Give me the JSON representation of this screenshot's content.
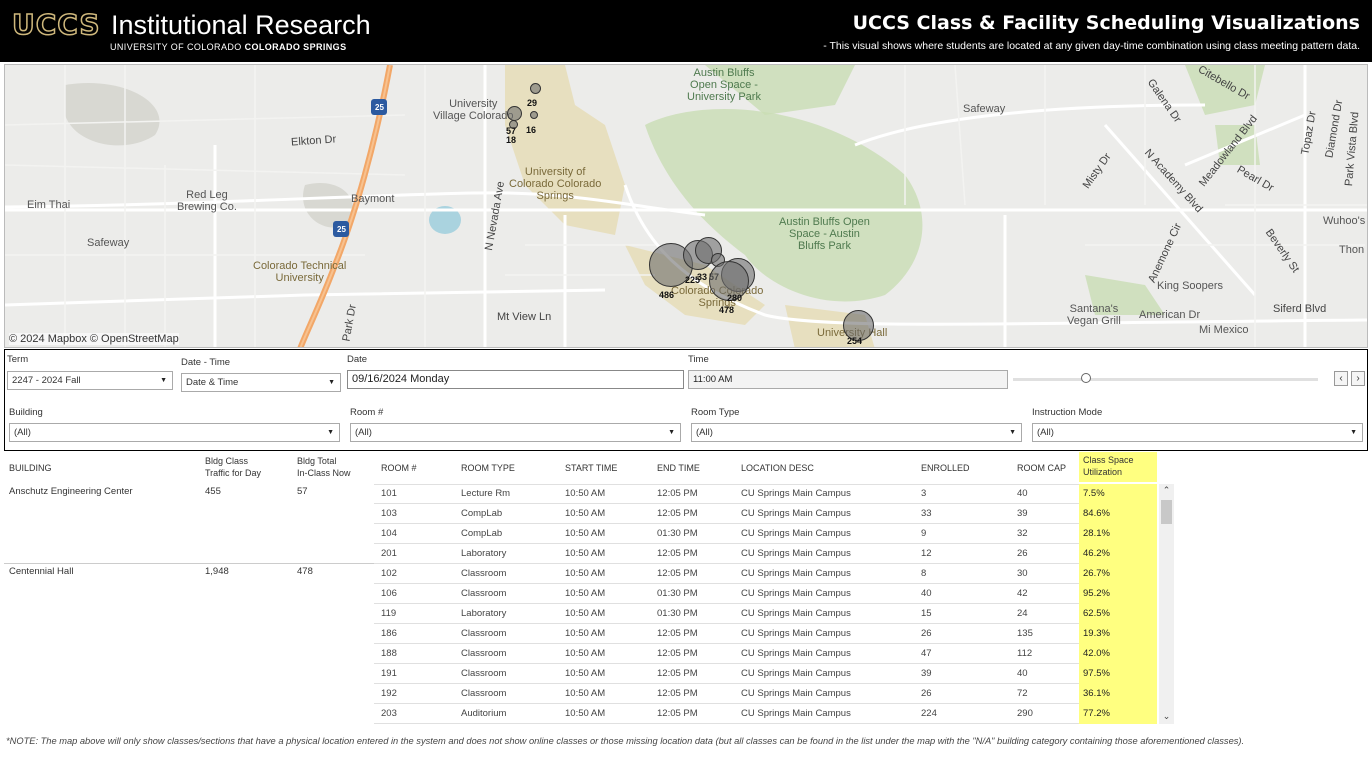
{
  "header": {
    "logo_uccs": "UCCS",
    "logo_ir": "Institutional Research",
    "logo_sub_prefix": "UNIVERSITY OF COLORADO",
    "logo_sub_bold": "COLORADO SPRINGS",
    "title": "UCCS Class & Facility Scheduling Visualizations",
    "subtitle": "- This visual shows where students are located at any given day-time combination using class meeting pattern data."
  },
  "map": {
    "attribution": "© 2024 Mapbox © OpenStreetMap",
    "labels": {
      "eim_thai": "Eim Thai",
      "safeway_w": "Safeway",
      "red_leg": "Red Leg\nBrewing Co.",
      "baymont": "Baymont",
      "elkton": "Elkton Dr",
      "colorado_tech": "Colorado Technical\nUniversity",
      "univ_village": "University\nVillage Colorado",
      "uccs": "University of\nColorado Colorado\nSprings",
      "n_nevada": "N Nevada Ave",
      "mt_view": "Mt View Ln",
      "austin_bluffs_top": "Austin Bluffs\nOpen Space -\nUniversity Park",
      "austin_bluffs_mid": "Austin Bluffs Open\nSpace - Austin\nBluffs Park",
      "safeway_e": "Safeway",
      "misty": "Misty Dr",
      "n_academy": "N Academy Blvd",
      "meadowland": "Meadowland Blvd",
      "pearl": "Pearl Dr",
      "anemone": "Anemone Cir",
      "beverly": "Beverly St",
      "king_soopers": "King Soopers",
      "santanas": "Santana's\nVegan Grill",
      "american": "American Dr",
      "mi_mexico": "Mi Mexico",
      "siferd": "Siferd Blvd",
      "wuhoos": "Wuhoo's",
      "thon": "Thon",
      "univ_hall": "University Hall",
      "galena": "Galena Dr",
      "diamond": "Diamond Dr",
      "topaz": "Topaz Dr",
      "park_vista": "Park Vista Blvd",
      "citebello": "Citebello Dr",
      "colorado_springs_partial": "Colorado Colorado\nSprings",
      "i25": "25",
      "park_dr": "Park Dr"
    },
    "bubbles": [
      {
        "label": "29",
        "value": 29
      },
      {
        "label": "57",
        "value": 57
      },
      {
        "label": "18",
        "value": 18
      },
      {
        "label": "16",
        "value": 16
      },
      {
        "label": "486",
        "value": 486
      },
      {
        "label": "225",
        "value": 225
      },
      {
        "label": "33",
        "value": 33
      },
      {
        "label": "57",
        "value": 57
      },
      {
        "label": "280",
        "value": 280
      },
      {
        "label": "478",
        "value": 478
      },
      {
        "label": "254",
        "value": 254
      }
    ]
  },
  "filters": {
    "term_label": "Term",
    "term_value": "2247 - 2024 Fall",
    "datetime_label": "Date - Time",
    "datetime_value": "Date & Time",
    "date_label": "Date",
    "date_value": "09/16/2024 Monday",
    "time_label": "Time",
    "time_value": "11:00 AM",
    "slider_fraction": 0.24,
    "prev": "‹",
    "next": "›",
    "building_label": "Building",
    "building_value": "(All)",
    "room_label": "Room #",
    "room_value": "(All)",
    "roomtype_label": "Room Type",
    "roomtype_value": "(All)",
    "mode_label": "Instruction Mode",
    "mode_value": "(All)"
  },
  "table": {
    "headers": {
      "building": "BUILDING",
      "traffic": "Bldg Class\nTraffic for Day",
      "inclass": "Bldg Total\nIn-Class Now",
      "room": "ROOM #",
      "roomtype": "ROOM TYPE",
      "start": "START TIME",
      "end": "END TIME",
      "location": "LOCATION DESC",
      "enrolled": "ENROLLED",
      "cap": "ROOM CAP",
      "util": "Class Space\nUtilization"
    },
    "buildings": [
      {
        "name": "Anschutz Engineering Center",
        "traffic": "455",
        "inclass": "57"
      },
      {
        "name": "Centennial Hall",
        "traffic": "1,948",
        "inclass": "478"
      }
    ],
    "rows": [
      {
        "room": "101",
        "type": "Lecture Rm",
        "start": "10:50 AM",
        "end": "12:05 PM",
        "loc": "CU Springs Main Campus",
        "enrolled": "3",
        "cap": "40",
        "util": "7.5%"
      },
      {
        "room": "103",
        "type": "CompLab",
        "start": "10:50 AM",
        "end": "12:05 PM",
        "loc": "CU Springs Main Campus",
        "enrolled": "33",
        "cap": "39",
        "util": "84.6%"
      },
      {
        "room": "104",
        "type": "CompLab",
        "start": "10:50 AM",
        "end": "01:30 PM",
        "loc": "CU Springs Main Campus",
        "enrolled": "9",
        "cap": "32",
        "util": "28.1%"
      },
      {
        "room": "201",
        "type": "Laboratory",
        "start": "10:50 AM",
        "end": "12:05 PM",
        "loc": "CU Springs Main Campus",
        "enrolled": "12",
        "cap": "26",
        "util": "46.2%"
      },
      {
        "room": "102",
        "type": "Classroom",
        "start": "10:50 AM",
        "end": "12:05 PM",
        "loc": "CU Springs Main Campus",
        "enrolled": "8",
        "cap": "30",
        "util": "26.7%"
      },
      {
        "room": "106",
        "type": "Classroom",
        "start": "10:50 AM",
        "end": "01:30 PM",
        "loc": "CU Springs Main Campus",
        "enrolled": "40",
        "cap": "42",
        "util": "95.2%"
      },
      {
        "room": "119",
        "type": "Laboratory",
        "start": "10:50 AM",
        "end": "01:30 PM",
        "loc": "CU Springs Main Campus",
        "enrolled": "15",
        "cap": "24",
        "util": "62.5%"
      },
      {
        "room": "186",
        "type": "Classroom",
        "start": "10:50 AM",
        "end": "12:05 PM",
        "loc": "CU Springs Main Campus",
        "enrolled": "26",
        "cap": "135",
        "util": "19.3%"
      },
      {
        "room": "188",
        "type": "Classroom",
        "start": "10:50 AM",
        "end": "12:05 PM",
        "loc": "CU Springs Main Campus",
        "enrolled": "47",
        "cap": "112",
        "util": "42.0%"
      },
      {
        "room": "191",
        "type": "Classroom",
        "start": "10:50 AM",
        "end": "12:05 PM",
        "loc": "CU Springs Main Campus",
        "enrolled": "39",
        "cap": "40",
        "util": "97.5%"
      },
      {
        "room": "192",
        "type": "Classroom",
        "start": "10:50 AM",
        "end": "12:05 PM",
        "loc": "CU Springs Main Campus",
        "enrolled": "26",
        "cap": "72",
        "util": "36.1%"
      },
      {
        "room": "203",
        "type": "Auditorium",
        "start": "10:50 AM",
        "end": "12:05 PM",
        "loc": "CU Springs Main Campus",
        "enrolled": "224",
        "cap": "290",
        "util": "77.2%"
      }
    ],
    "scroll_up": "⌃",
    "scroll_down": "⌄"
  },
  "note": "*NOTE: The map above will only show classes/sections that have a physical location entered in the system and does not show online classes or those missing location data (but all classes can be found in the list  under the map with the \"N/A\" building category containing those aforementioned classes).",
  "colors": {
    "highlight": "#ffff80",
    "header_bg": "#000000",
    "uccs_gold": "#cfb87c",
    "bubble": "#6e6e6e"
  }
}
